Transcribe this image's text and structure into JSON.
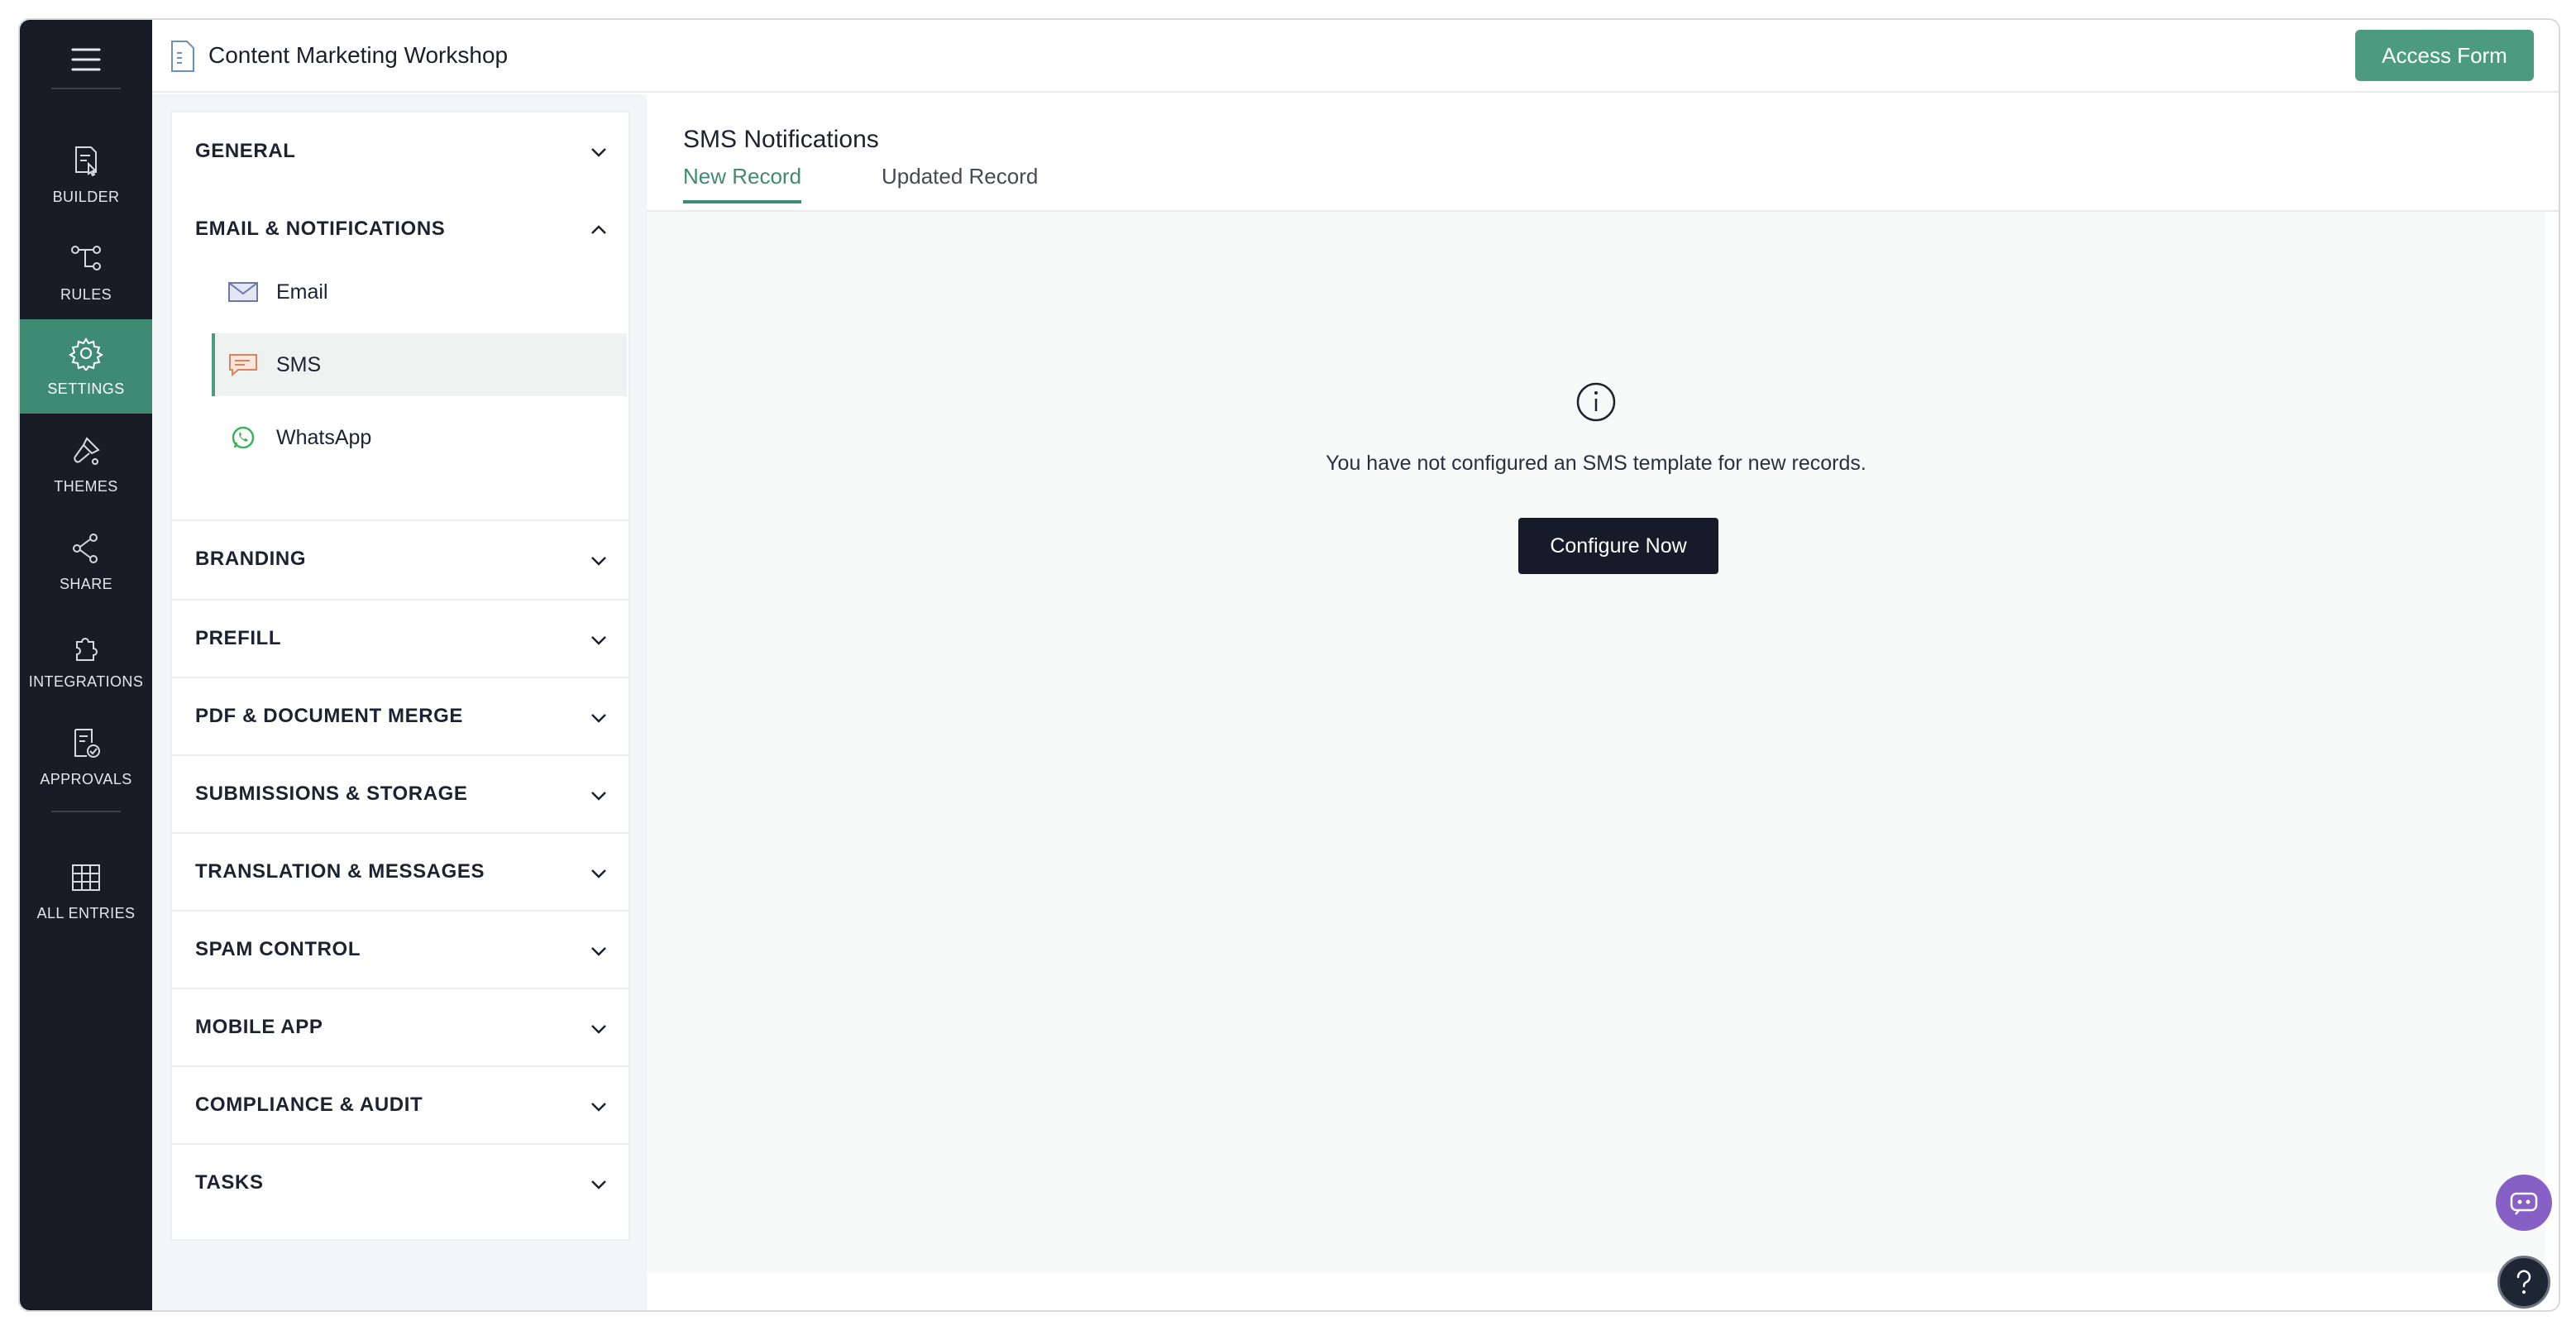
{
  "app": {
    "form_title": "Content Marketing Workshop",
    "access_button_label": "Access Form"
  },
  "rail": {
    "items": [
      {
        "label": "BUILDER",
        "icon": "builder-icon"
      },
      {
        "label": "RULES",
        "icon": "rules-icon"
      },
      {
        "label": "SETTINGS",
        "icon": "gear-icon",
        "active": true
      },
      {
        "label": "THEMES",
        "icon": "brush-icon"
      },
      {
        "label": "SHARE",
        "icon": "share-icon"
      },
      {
        "label": "INTEGRATIONS",
        "icon": "puzzle-icon"
      },
      {
        "label": "APPROVALS",
        "icon": "approvals-icon"
      },
      {
        "label": "ALL ENTRIES",
        "icon": "grid-icon"
      }
    ]
  },
  "settings": {
    "sections": [
      {
        "label": "GENERAL",
        "expanded": false
      },
      {
        "label": "EMAIL & NOTIFICATIONS",
        "expanded": true
      },
      {
        "label": "BRANDING",
        "expanded": false
      },
      {
        "label": "PREFILL",
        "expanded": false
      },
      {
        "label": "PDF & DOCUMENT MERGE",
        "expanded": false
      },
      {
        "label": "SUBMISSIONS & STORAGE",
        "expanded": false
      },
      {
        "label": "TRANSLATION & MESSAGES",
        "expanded": false
      },
      {
        "label": "SPAM CONTROL",
        "expanded": false
      },
      {
        "label": "MOBILE APP",
        "expanded": false
      },
      {
        "label": "COMPLIANCE & AUDIT",
        "expanded": false
      },
      {
        "label": "TASKS",
        "expanded": false
      }
    ],
    "notification_items": [
      {
        "label": "Email",
        "icon": "envelope-icon"
      },
      {
        "label": "SMS",
        "icon": "chat-bubble-icon",
        "active": true
      },
      {
        "label": "WhatsApp",
        "icon": "whatsapp-icon"
      }
    ]
  },
  "main": {
    "title": "SMS Notifications",
    "tabs": [
      {
        "label": "New Record",
        "active": true
      },
      {
        "label": "Updated Record",
        "active": false
      }
    ],
    "empty_message": "You have not configured an SMS template for new records.",
    "configure_button_label": "Configure Now"
  },
  "colors": {
    "rail_bg": "#171c26",
    "accent": "#4c9b80",
    "primary_button": "#151b28",
    "bot_button": "#8660c5"
  }
}
